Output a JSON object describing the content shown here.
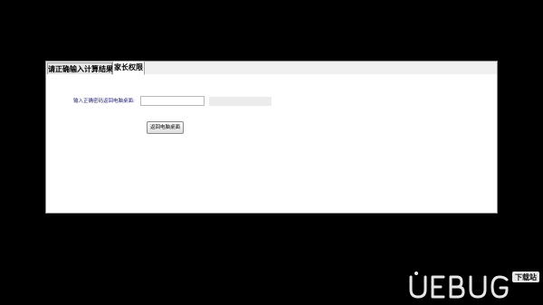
{
  "tabs": [
    {
      "label": "请正确输入计算结果",
      "active": false
    },
    {
      "label": "家长权限",
      "active": true
    }
  ],
  "form": {
    "password_label": "输入正确密码返回电脑桌面:",
    "password_value": "",
    "return_button_label": "返回电脑桌面"
  },
  "watermark": {
    "brand": "UEBUG",
    "badge": "下载站"
  },
  "colors": {
    "screen_background": "#000000",
    "window_background": "#f0f0f0",
    "panel_background": "#ffffff",
    "label_text": "#1a1a6e"
  }
}
